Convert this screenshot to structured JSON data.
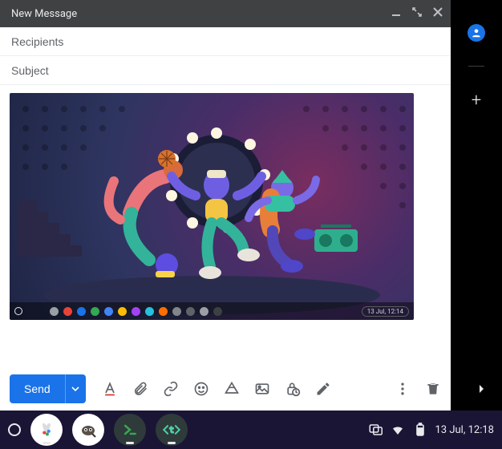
{
  "compose": {
    "title": "New Message",
    "recipients_placeholder": "Recipients",
    "recipients_value": "",
    "subject_placeholder": "Subject",
    "subject_value": "",
    "send_label": "Send"
  },
  "toolbarIcons": {
    "format": "format-text-icon",
    "attach": "paperclip-icon",
    "link": "link-icon",
    "emoji": "emoji-icon",
    "drive": "drive-icon",
    "photo": "photo-icon",
    "confidential": "lock-clock-icon",
    "pen": "pen-icon",
    "more": "more-vert-icon",
    "discard": "trash-icon"
  },
  "attachment": {
    "inner_taskbar_time": "13 Jul, 12:14",
    "shelf_dot_colors": [
      "#9aa0a6",
      "#ea4335",
      "#34a853",
      "#1a73e8",
      "#fbbc04",
      "#4285f4",
      "#8ab4f8",
      "#a142f4",
      "#24c1e0",
      "#ff6d01",
      "#80868b",
      "#5f6368",
      "#9aa0a6",
      "#202124"
    ]
  },
  "system": {
    "date_time": "13 Jul, 12:18"
  },
  "colors": {
    "accent": "#1a73e8",
    "titlebar_bg": "#404143",
    "shelf_bg": "#1a1535"
  }
}
